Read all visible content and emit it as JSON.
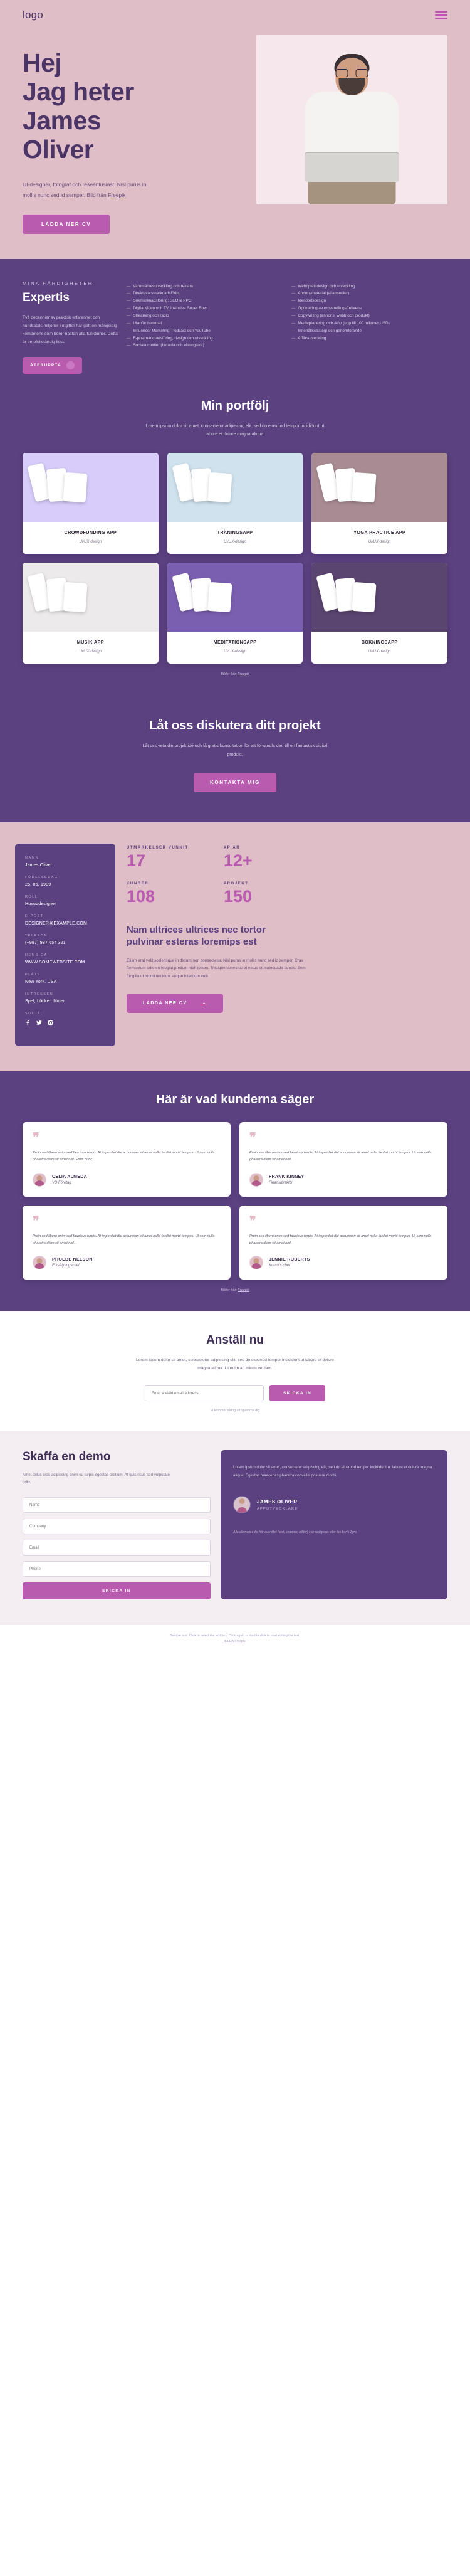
{
  "header": {
    "logo": "logo",
    "menu_icon": "hamburger-menu-icon"
  },
  "hero": {
    "title_lines": [
      "Hej",
      "Jag heter",
      "James",
      "Oliver"
    ],
    "description": "UI-designer, fotograf och reseentusiast. Nisl purus in mollis nunc sed id semper. Bild från ",
    "description_link": "Freepik",
    "cta": "LADDA NER CV"
  },
  "expertis": {
    "eyebrow": "MINA FÄRDIGHETER",
    "title": "Expertis",
    "body": "Två decennier av praktisk erfarenhet och hundratals miljoner i utgifter har gett en mångsidig kompetens som berör nästan alla funktioner. Detta är en ofullständig lista.",
    "chip_label": "ÅTERUPPTA",
    "col1": [
      "Varumärkesutveckling och reklam",
      "Direktsvarsmarknadsföring",
      "Sökmarknadsföring: SEO & PPC",
      "Digital video och TV, inklusive Super Bowl",
      "Streaming och radio",
      "Utanför hemmet",
      "Influencer Marketing: Podcast och YouTube",
      "E-postmarknadsföring, design och utveckling",
      "Sociala medier (betalda och ekologiska)"
    ],
    "col2": [
      "Webbplatsdesign och utveckling",
      "Annonsmaterial (alla medier)",
      "Identitetsdesign",
      "Optimering av omvandlingsfrekvens",
      "Copywriting (annons, webb och produkt)",
      "Medieplanering och -köp (upp till 100 miljoner USD)",
      "Innehållsstrategi och genomförande",
      "Affärsutveckling"
    ]
  },
  "portfolio": {
    "title": "Min portfölj",
    "subtitle": "Lorem ipsum dolor sit amet, consectetur adipiscing elit, sed do eiusmod tempor incididunt ut labore et dolore magna aliqua.",
    "items": [
      {
        "title": "CROWDFUNDING APP",
        "subtitle": "UI/UX-design"
      },
      {
        "title": "TRÄNINGSAPP",
        "subtitle": "UI/UX-design"
      },
      {
        "title": "YOGA PRACTICE APP",
        "subtitle": "UI/UX-design"
      },
      {
        "title": "MUSIK APP",
        "subtitle": "UI/UX-design"
      },
      {
        "title": "MEDITATIONSAPP",
        "subtitle": "UI/UX-design"
      },
      {
        "title": "BOKNINGSAPP",
        "subtitle": "UI/UX-design"
      }
    ],
    "credit_prefix": "Bilder från ",
    "credit_link": "Freepik"
  },
  "discuss": {
    "title": "Låt oss diskutera ditt projekt",
    "subtitle": "Låt oss veta din projektidé och få gratis konsultation för att förvandla den till en fantastisk digital produkt.",
    "cta": "KONTAKTA MIG"
  },
  "profile": {
    "fields": [
      {
        "label": "NAMN",
        "value": "James Oliver"
      },
      {
        "label": "FÖDELSEDAG",
        "value": "25. 05. 1989"
      },
      {
        "label": "ROLL",
        "value": "Huvuddesigner"
      },
      {
        "label": "E-POST",
        "value": "DESIGNER@EXAMPLE.COM"
      },
      {
        "label": "TELEFON",
        "value": "(+987) 987 654 321"
      },
      {
        "label": "HEMSIDA",
        "value": "WWW.SOMEWEBSITE.COM"
      },
      {
        "label": "PLATS",
        "value": "New York, USA"
      },
      {
        "label": "INTRESSEN",
        "value": "Spel, böcker, filmer"
      }
    ],
    "social_label": "SOCIAL",
    "social_icons": [
      "facebook-icon",
      "twitter-icon",
      "instagram-icon"
    ],
    "stats": [
      {
        "label": "UTMÄRKELSER VUNNIT",
        "value": "17"
      },
      {
        "label": "XP ÅR",
        "value": "12+"
      },
      {
        "label": "KUNDER",
        "value": "108"
      },
      {
        "label": "PROJEKT",
        "value": "150"
      }
    ],
    "title": "Nam ultrices ultrices nec tortor pulvinar esteras loremips est",
    "text": "Etiam erat velit scelerisque in dictum non consectetur. Nisl purus in mollis nunc sed id semper. Cras fermentum odio eu feugiat pretium nibh ipsum. Tristique senectus et netus et malesuada fames. Sem fringilla ut morbi tincidunt augue interdum velit.",
    "cta": "LADDA NER CV"
  },
  "testimonials": {
    "title": "Här är vad kunderna säger",
    "items": [
      {
        "text": "Proin sed libero enim sed faucibus turpis. At imperdiet dui accumsan sit amet nulla facilisi morbi tempus. Ut sem nulla pharetra diam sit amet nisl. Enim nunc",
        "name": "CELIA ALMEDA",
        "role": "VD Företag"
      },
      {
        "text": "Proin sed libero enim sed faucibus turpis. At imperdiet dui accumsan sit amet nulla facilisi morbi tempus. Ut sem nulla pharetra diam sit amet nisl.",
        "name": "FRANK KINNEY",
        "role": "Finansdirektör"
      },
      {
        "text": "Proin sed libero enim sed faucibus turpis. At imperdiet dui accumsan sit amet nulla facilisi morbi tempus. Ut sem nulla pharetra diam sit amet nisl. .",
        "name": "PHOEBE NELSON",
        "role": "Försäljningschef"
      },
      {
        "text": "Proin sed libero enim sed faucibus turpis. At imperdiet dui accumsan sit amet nulla facilisi morbi tempus. Ut sem nulla pharetra diam sit amet nisl.",
        "name": "JENNIE ROBERTS",
        "role": "Kontors chef"
      }
    ],
    "credit_prefix": "Bilder från ",
    "credit_link": "Freepik"
  },
  "newsletter": {
    "title": "Anställ nu",
    "subtitle": "Lorem ipsum dolor sit amet, consectetur adipiscing elit, sed do eiusmod tempor incididunt ut labore et dolore magna aliqua. Ut enim ad minim veniam.",
    "email_placeholder": "Enter a valid email address",
    "submit": "SKICKA IN",
    "note": "Vi kommer aldrig att spamma dig"
  },
  "demo": {
    "title": "Skaffa en demo",
    "subtitle": "Amet tellus cras adipiscing enim eu turpis egestas pretium. At quis risus sed vulputate odio.",
    "fields": [
      {
        "placeholder": "Name"
      },
      {
        "placeholder": "Company"
      },
      {
        "placeholder": "Email"
      },
      {
        "placeholder": "Phone"
      }
    ],
    "submit": "SKICKA IN",
    "quote": "Lorem ipsum dolor sit amet, consectetur adipiscing elit, sed do eiusmod tempor incididunt ut labore et dolore magna aliqua. Egestas maecenas pharetra convallis posuere morbi.",
    "author_name": "JAMES OLIVER",
    "author_role": "APPUTVECKLARE",
    "credit": "Alla element i det här avsnittet (text, knappar, bilder) kan redigeras eller tas bort i Zyro."
  },
  "footer": {
    "text": "Sample text. Click to select the text box. Click again or double click to start editing the text.",
    "link": "BILDA Freepik"
  }
}
